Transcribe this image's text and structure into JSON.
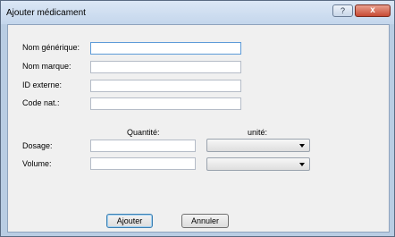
{
  "window": {
    "title": "Ajouter médicament",
    "help_label": "?",
    "close_label": "x"
  },
  "form": {
    "generic_name": {
      "label": "Nom générique:",
      "value": ""
    },
    "brand_name": {
      "label": "Nom marque:",
      "value": ""
    },
    "external_id": {
      "label": "ID externe:",
      "value": ""
    },
    "nat_code": {
      "label": "Code nat.:",
      "value": ""
    },
    "quantity_header": "Quantité:",
    "unit_header": "unité:",
    "dosage": {
      "label": "Dosage:",
      "quantity": "",
      "unit": ""
    },
    "volume": {
      "label": "Volume:",
      "quantity": "",
      "unit": ""
    }
  },
  "buttons": {
    "add": "Ajouter",
    "cancel": "Annuler"
  }
}
